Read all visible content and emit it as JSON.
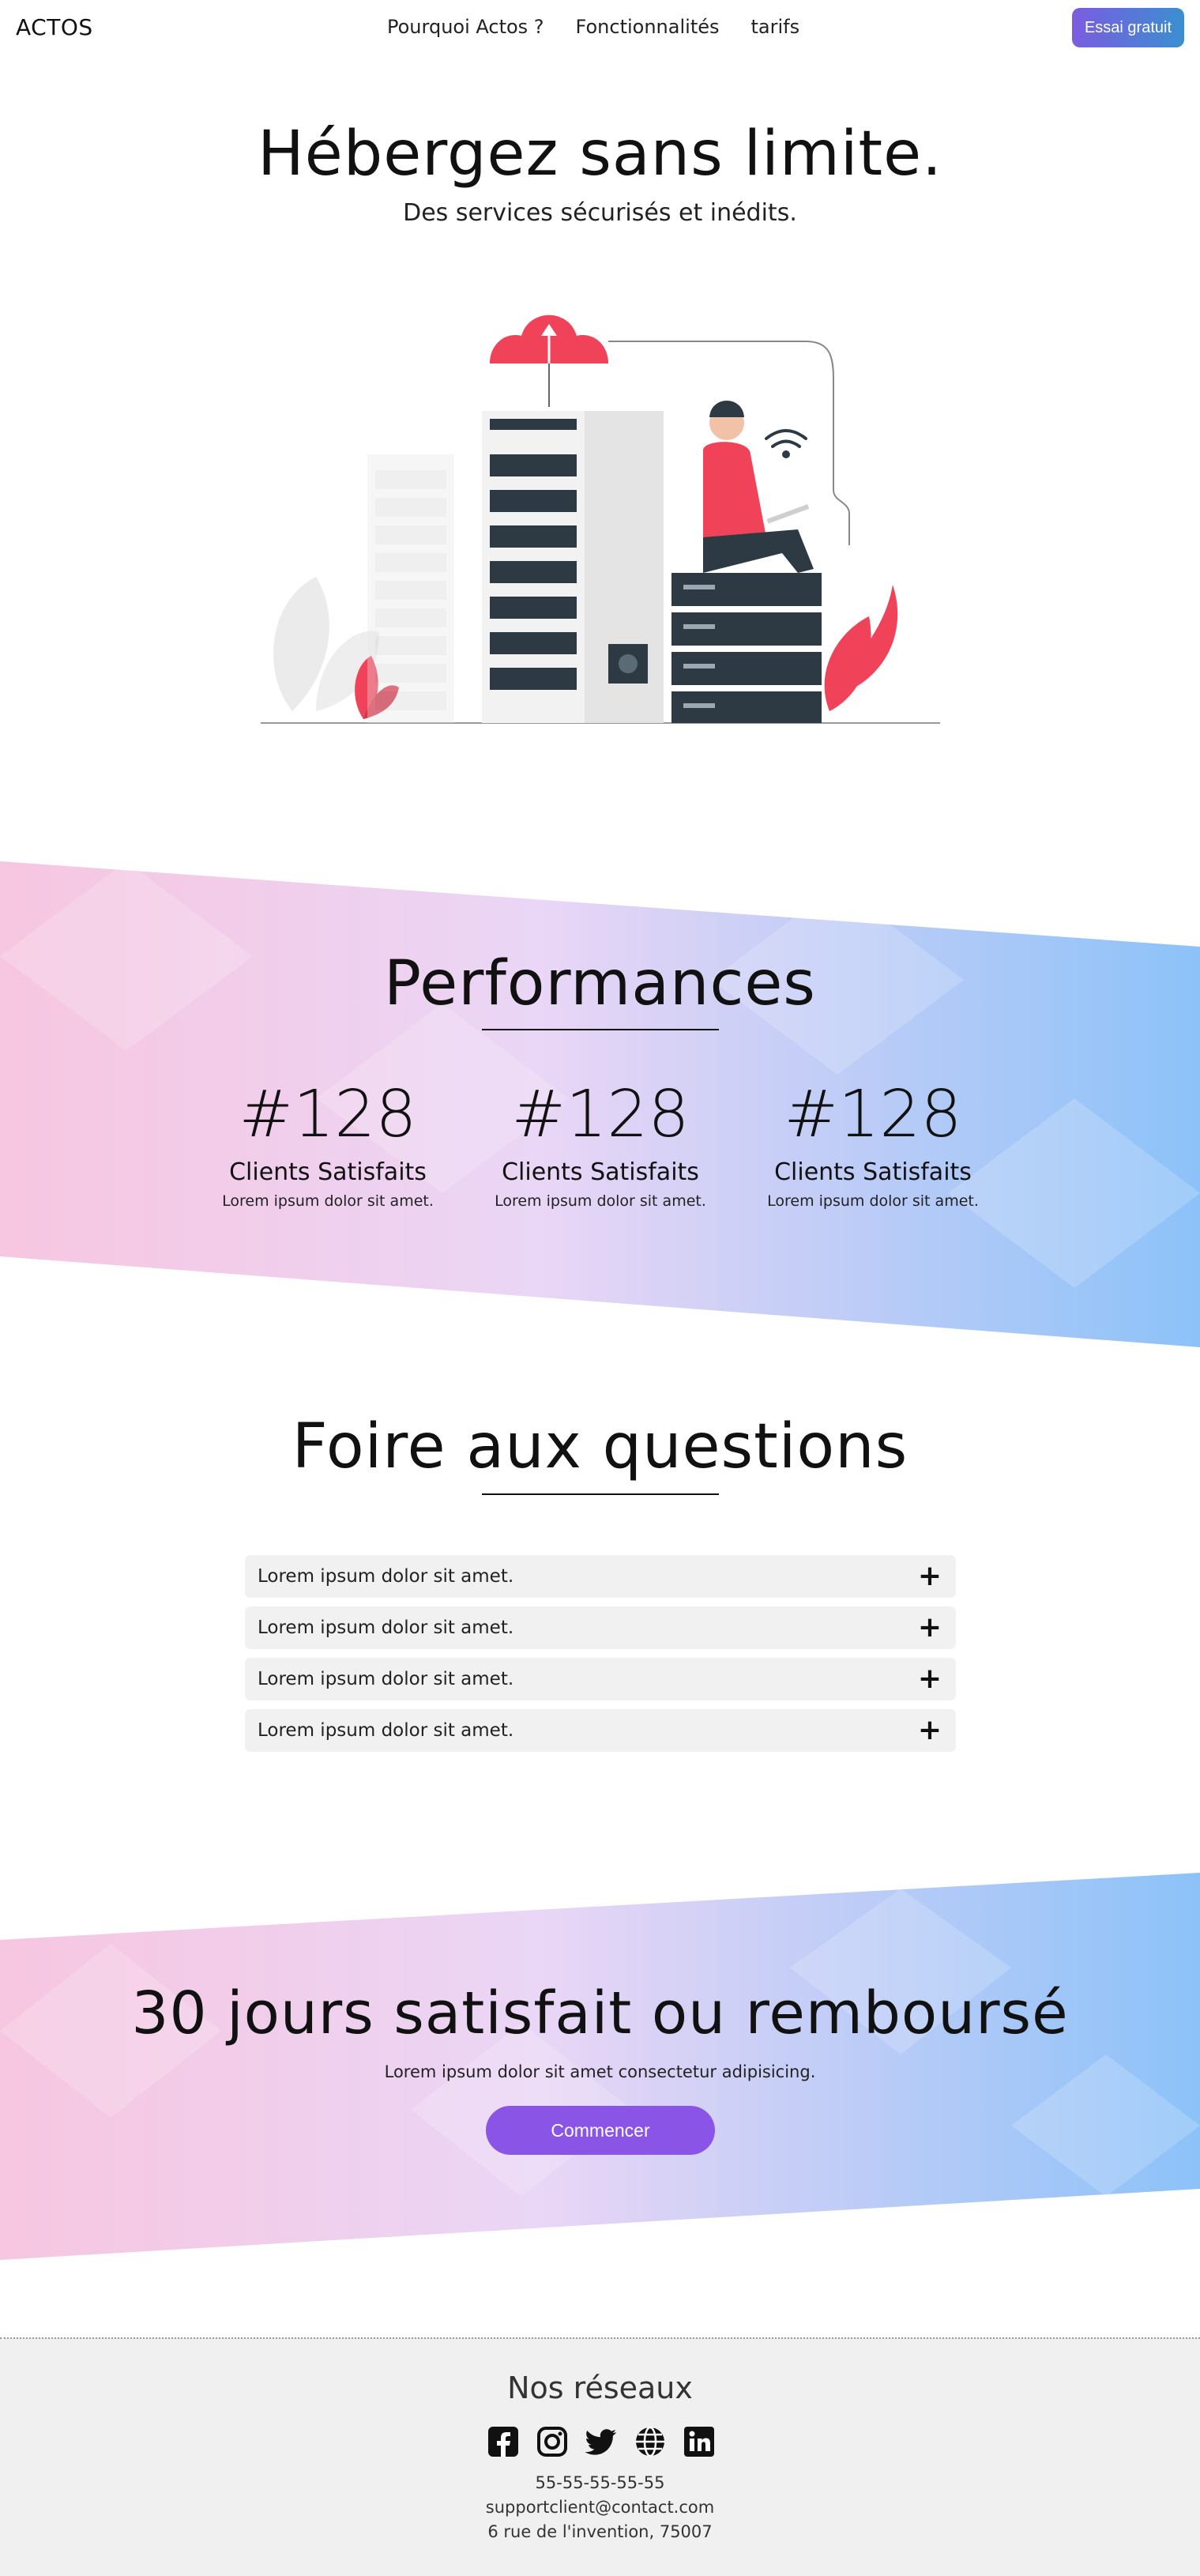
{
  "nav": {
    "logo": "ACTOS",
    "links": [
      "Pourquoi Actos ?",
      "Fonctionnalités",
      "tarifs"
    ],
    "cta": "Essai gratuit"
  },
  "hero": {
    "title": "Hébergez sans limite.",
    "subtitle": "Des services sécurisés et inédits."
  },
  "performance": {
    "title": "Performances",
    "stats": [
      {
        "value": "#128",
        "label": "Clients Satisfaits",
        "desc": "Lorem ipsum dolor sit amet."
      },
      {
        "value": "#128",
        "label": "Clients Satisfaits",
        "desc": "Lorem ipsum dolor sit amet."
      },
      {
        "value": "#128",
        "label": "Clients Satisfaits",
        "desc": "Lorem ipsum dolor sit amet."
      }
    ]
  },
  "faq": {
    "title": "Foire aux questions",
    "items": [
      "Lorem ipsum dolor sit amet.",
      "Lorem ipsum dolor sit amet.",
      "Lorem ipsum dolor sit amet.",
      "Lorem ipsum dolor sit amet."
    ],
    "expand_icon": "plus-icon"
  },
  "guarantee": {
    "title": "30 jours satisfait ou remboursé",
    "subtitle": "Lorem ipsum dolor sit amet consectetur adipisicing.",
    "button": "Commencer"
  },
  "footer": {
    "title": "Nos réseaux",
    "socials": [
      "facebook-icon",
      "instagram-icon",
      "twitter-icon",
      "globe-icon",
      "linkedin-icon"
    ],
    "phone": "55-55-55-55-55",
    "email": "supportclient@contact.com",
    "address": "6 rue de l'invention, 75007"
  },
  "colors": {
    "accent": "#8a55e6",
    "cta_start": "#7b5ce0",
    "cta_end": "#3a8fd0",
    "band_pink": "#f7c6e0",
    "band_blue": "#8cc2f8",
    "illustration_red": "#f0435a",
    "footer_bg": "#f0f0f0"
  }
}
